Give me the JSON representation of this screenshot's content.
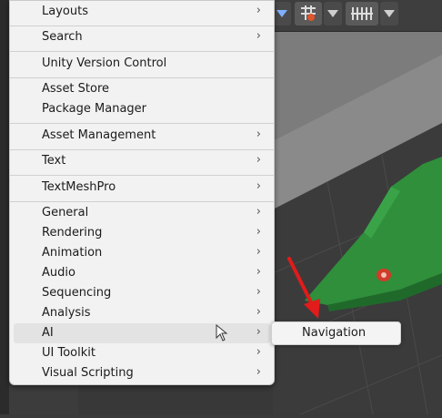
{
  "menu": {
    "items": [
      {
        "label": "Layouts",
        "submenu": true
      },
      {
        "label": "Search",
        "submenu": true
      },
      {
        "label": "Unity Version Control",
        "submenu": false
      },
      {
        "label": "Asset Store",
        "submenu": false
      },
      {
        "label": "Package Manager",
        "submenu": false
      },
      {
        "label": "Asset Management",
        "submenu": true
      },
      {
        "label": "Text",
        "submenu": true
      },
      {
        "label": "TextMeshPro",
        "submenu": true
      },
      {
        "label": "General",
        "submenu": true
      },
      {
        "label": "Rendering",
        "submenu": true
      },
      {
        "label": "Animation",
        "submenu": true
      },
      {
        "label": "Audio",
        "submenu": true
      },
      {
        "label": "Sequencing",
        "submenu": true
      },
      {
        "label": "Analysis",
        "submenu": true
      },
      {
        "label": "AI",
        "submenu": true
      },
      {
        "label": "UI Toolkit",
        "submenu": true
      },
      {
        "label": "Visual Scripting",
        "submenu": true
      }
    ],
    "chevron": "›"
  },
  "submenu": {
    "items": [
      {
        "label": "Navigation"
      }
    ]
  },
  "colors": {
    "menu_bg": "#f2f2f2",
    "highlight": "#e3e3e3",
    "annotation_arrow": "#e21b1b",
    "scene_plane": "#2e8b3a"
  },
  "icons": {
    "toolbar": [
      "dropdown-arrow-icon",
      "gizmo-icon",
      "grid-snap-icon"
    ]
  }
}
